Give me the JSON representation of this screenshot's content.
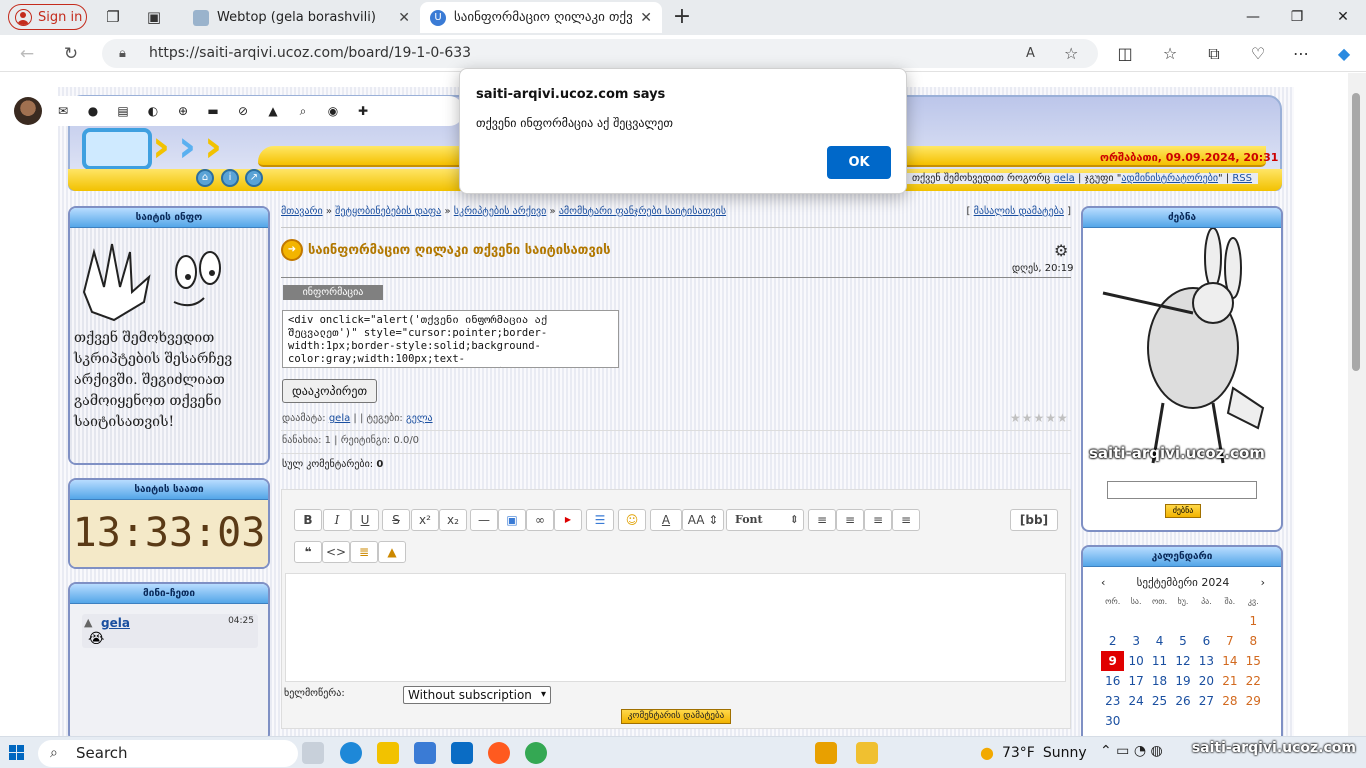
{
  "browser": {
    "signin_label": "Sign in",
    "tabs": [
      {
        "title": "Webtop (gela borashvili)",
        "active": false
      },
      {
        "title": "საინფორმაციო ღილაკი თქვე",
        "active": true
      }
    ],
    "new_tab_symbol": "+",
    "url": "https://saiti-arqivi.ucoz.com/board/19-1-0-633"
  },
  "header": {
    "datetime": "ორშაბათი, 09.09.2024, 20:31",
    "greeting": "თქვენ შემოხვედით როგორც",
    "user": "gela",
    "group_prefix": "| ჯგუფი \"",
    "group": "ადმინისტრატორები",
    "group_suffix": "\" |",
    "rss": "RSS"
  },
  "left": {
    "info_title": "საიტის ინფო",
    "info_text": "თქვენ შემოხვედით სკრიპტების შესარჩევ არქივში. შეგიძლიათ გამოიყენოთ თქვენი საიტისათვის!",
    "clock_title": "საიტის საათი",
    "clock_value": "13:33:03",
    "chat_title": "მინი-ჩეთი",
    "chat_user": "gela",
    "chat_time": "04:25",
    "chat_emoji": "😭"
  },
  "breadcrumbs": [
    "მთავარი",
    "შეტყობინებების დაფა",
    "სკრიპტების არქივი",
    "ამომხტარი ფანჯრები საიტისათვის"
  ],
  "breadcrumb_separator": "»",
  "add_material": "მასალის დამატება",
  "post": {
    "title": "საინფორმაციო ღილაკი თქვენი საიტისათვის",
    "time": "დღეს, 20:19",
    "info_button_label": "ინფორმაცია",
    "code": "<div onclick=\"alert('თქვენი ინფორმაცია აქ შეცვალეთ')\" style=\"cursor:pointer;border-width:1px;border-style:solid;background-color:gray;width:100px;text-align:center;color:#ffffff;\">ინფორმაცია</div>",
    "copy_button": "დააკოპირეთ",
    "added_label": "დაამატა:",
    "added_by": "gela",
    "tags_label": "| | ტეგები:",
    "tags": "გელა",
    "views": "ნანახია: 1 | რეიტინგი: 0.0/0",
    "comments_label": "სულ კომენტარები:",
    "comments_count": "0"
  },
  "editor": {
    "bb_label": "[bb]",
    "font_label": "Font",
    "subscription_label": "ხელმოწერა:",
    "subscription_value": "Without subscription",
    "add_comment": "კომენტარის დამატება"
  },
  "right": {
    "search_title": "ძებნა",
    "search_button": "ძებნა",
    "watermark": "saiti-arqivi.ucoz.com",
    "calendar_title": "კალენდარი",
    "month": "სექტემბერი 2024",
    "weekdays": [
      "ორ.",
      "სა.",
      "ოთ.",
      "ხუ.",
      "პა.",
      "შა.",
      "კვ."
    ],
    "days": [
      "",
      "",
      "",
      "",
      "",
      "",
      "1",
      "2",
      "3",
      "4",
      "5",
      "6",
      "7",
      "8",
      "9",
      "10",
      "11",
      "12",
      "13",
      "14",
      "15",
      "16",
      "17",
      "18",
      "19",
      "20",
      "21",
      "22",
      "23",
      "24",
      "25",
      "26",
      "27",
      "28",
      "29",
      "30"
    ],
    "today": "9"
  },
  "dialog": {
    "title": "saiti-arqivi.ucoz.com says",
    "message": "თქვენი ინფორმაცია აქ შეცვალეთ",
    "ok": "OK"
  },
  "taskbar": {
    "search": "Search",
    "weather_temp": "73°F",
    "weather_desc": "Sunny",
    "watermark": "saiti-arqivi.ucoz.com"
  },
  "colors": {
    "accent": "#0068c9",
    "header_yellow": "#f5c000",
    "box_blue": "#54a6e8",
    "today_red": "#e00000"
  }
}
